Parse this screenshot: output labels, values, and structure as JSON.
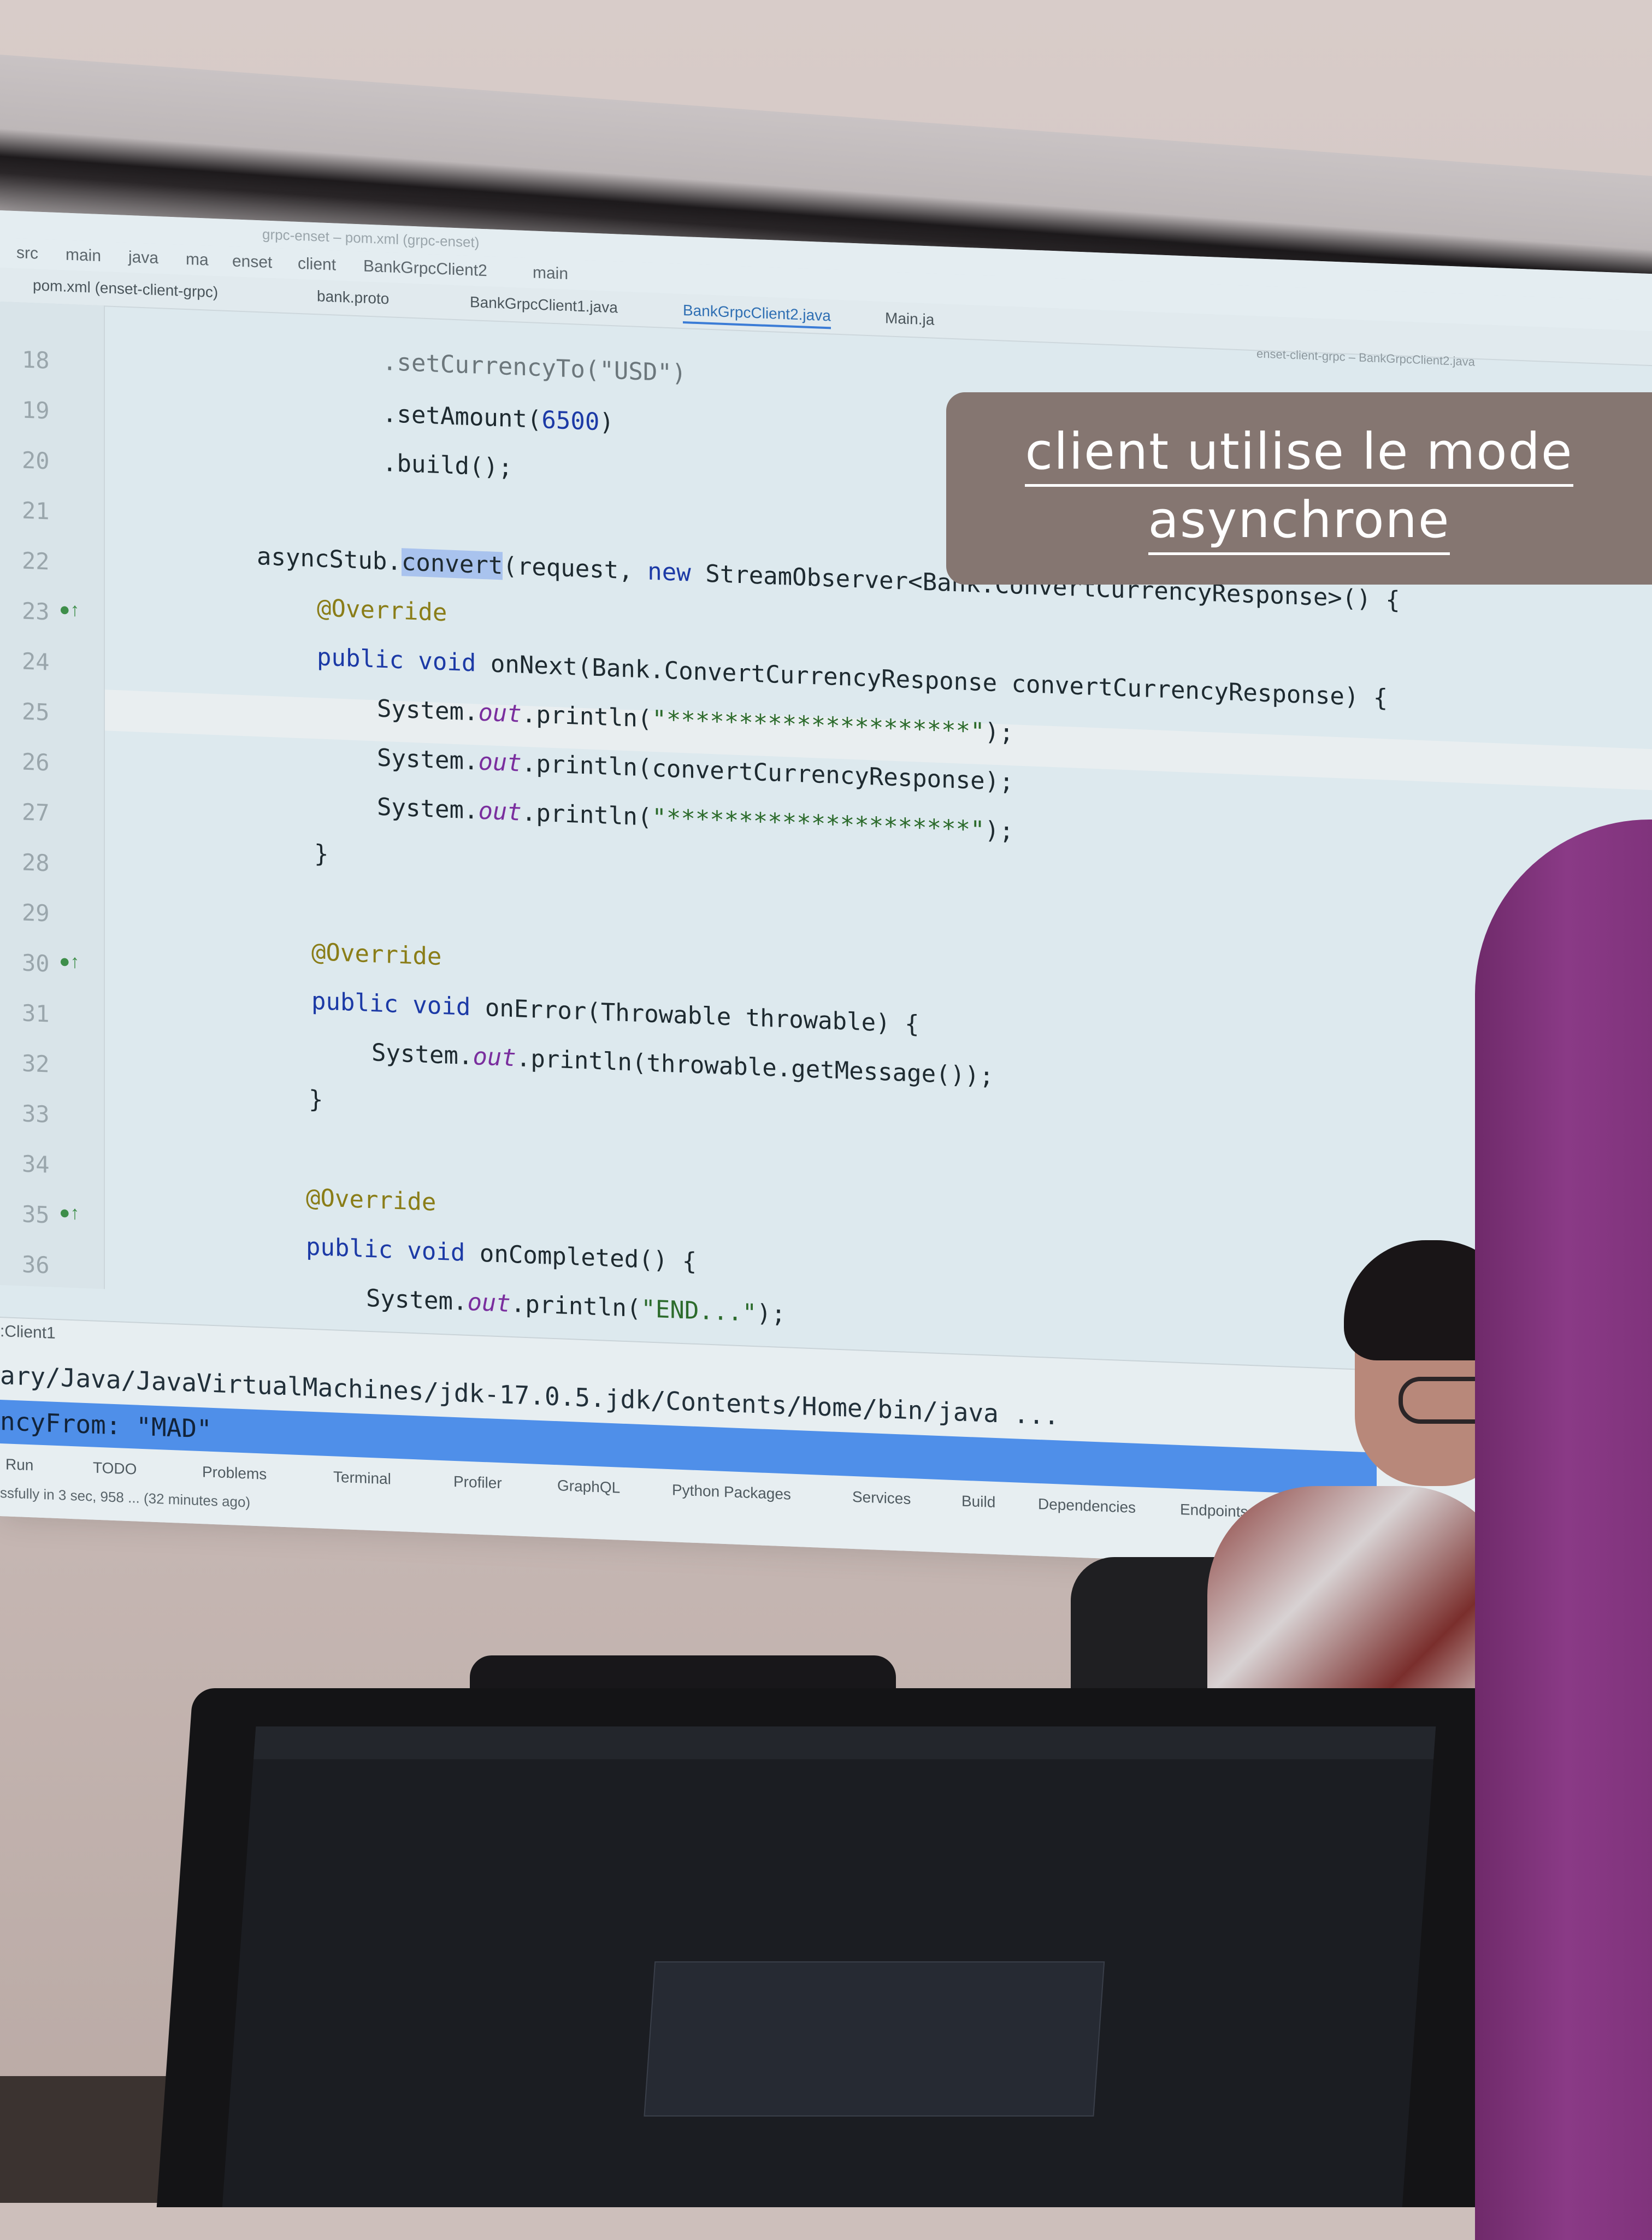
{
  "ide": {
    "window_title": "grpc-enset – pom.xml (grpc-enset)",
    "breadcrumb": [
      "src",
      "main",
      "java",
      "ma",
      "enset",
      "client",
      "BankGrpcClient2",
      "main"
    ],
    "tabs": [
      {
        "label": "pom.xml (enset-client-grpc)"
      },
      {
        "label": "bank.proto"
      },
      {
        "label": "BankGrpcClient1.java"
      },
      {
        "label": "BankGrpcClient2.java"
      },
      {
        "label": "Main.ja"
      }
    ],
    "right_title": "enset-client-grpc – BankGrpcClient2.java",
    "line_numbers": [
      "18",
      "19",
      "20",
      "21",
      "22",
      "23",
      "24",
      "25",
      "26",
      "27",
      "28",
      "29",
      "30",
      "31",
      "32",
      "33",
      "34",
      "35",
      "36"
    ],
    "code": {
      "l18": ".setCurrencyTo(\"USD\")",
      "l19_a": ".setAmount(",
      "l19_b": "6500",
      "l19_c": ")",
      "l20": ".build();",
      "l22_a": "asyncStub.",
      "l22_sel": "convert",
      "l22_b": "(request, ",
      "l22_new": "new",
      "l22_c": " StreamObserver<Bank.ConvertCurrencyResponse>() {",
      "override": "@Override",
      "public_void": "public void",
      "l24_rest": " onNext(Bank.ConvertCurrencyResponse convertCurrencyResponse) {",
      "sys": "System.",
      "out": "out",
      "println": ".println(",
      "stars": "\"*********************\"",
      "end_call": ");",
      "l26_arg": "convertCurrencyResponse);",
      "close_brace": "}",
      "l31_rest": " onError(Throwable throwable) {",
      "l32_arg": "throwable.getMessage());",
      "l36_rest": " onCompleted() {",
      "l37_str": "\"END...\""
    },
    "console": {
      "run_tab": ":Client1",
      "command": "ary/Java/JavaVirtualMachines/jdk-17.0.5.jdk/Contents/Home/bin/java ...",
      "highlight": "ncyFrom: \"MAD\""
    },
    "toolbar": [
      "Run",
      "TODO",
      "Problems",
      "Terminal",
      "Profiler",
      "GraphQL",
      "Python Packages",
      "Services",
      "Build",
      "Dependencies",
      "Endpoints"
    ],
    "status": "ssfully in 3 sec, 958 ... (32 minutes ago)"
  },
  "caption": {
    "line1": "client utilise le mode",
    "line2": "asynchrone",
    "background": "#857671"
  },
  "icons": {
    "override_gutter": "override-up-arrow-icon",
    "class_tab": "java-class-icon"
  }
}
